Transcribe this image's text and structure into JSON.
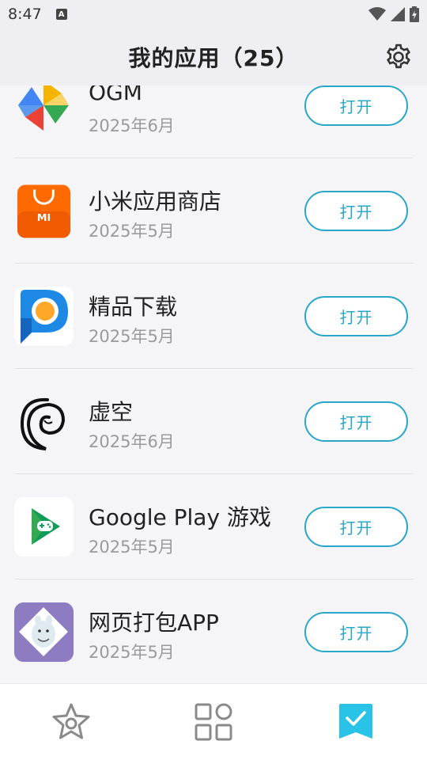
{
  "status_bar": {
    "time": "8:47",
    "notification_badge": "A"
  },
  "header": {
    "title": "我的应用（25）",
    "settings_icon": "gear-icon"
  },
  "apps": [
    {
      "name": "OGM",
      "date": "2025年6月",
      "button": "打开",
      "icon": "pinwheel-icon"
    },
    {
      "name": "小米应用商店",
      "date": "2025年5月",
      "button": "打开",
      "icon": "mi-store-icon"
    },
    {
      "name": "精品下载",
      "date": "2025年5月",
      "button": "打开",
      "icon": "p-logo-icon"
    },
    {
      "name": "虚空",
      "date": "2025年6月",
      "button": "打开",
      "icon": "swirl-icon"
    },
    {
      "name": "Google Play 游戏",
      "date": "2025年5月",
      "button": "打开",
      "icon": "google-play-games-icon"
    },
    {
      "name": "网页打包APP",
      "date": "2025年5月",
      "button": "打开",
      "icon": "moomin-icon"
    }
  ],
  "bottom_nav": [
    {
      "icon": "star-icon",
      "active": false
    },
    {
      "icon": "grid-icon",
      "active": false
    },
    {
      "icon": "checkmark-bookmark-icon",
      "active": true
    }
  ],
  "colors": {
    "accent": "#2aa6c9",
    "active_nav": "#29c3e8",
    "inactive_nav": "#8a8a8a"
  }
}
